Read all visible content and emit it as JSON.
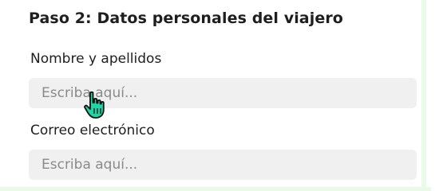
{
  "form": {
    "title": "Paso 2: Datos personales del viajero",
    "name_field": {
      "label": "Nombre y apellidos",
      "placeholder": "Escriba aquí..."
    },
    "email_field": {
      "label": "Correo electrónico",
      "placeholder": "Escriba aquí..."
    }
  },
  "cursor": {
    "icon": "hand-pointer-icon",
    "color": "#22d3a5"
  }
}
